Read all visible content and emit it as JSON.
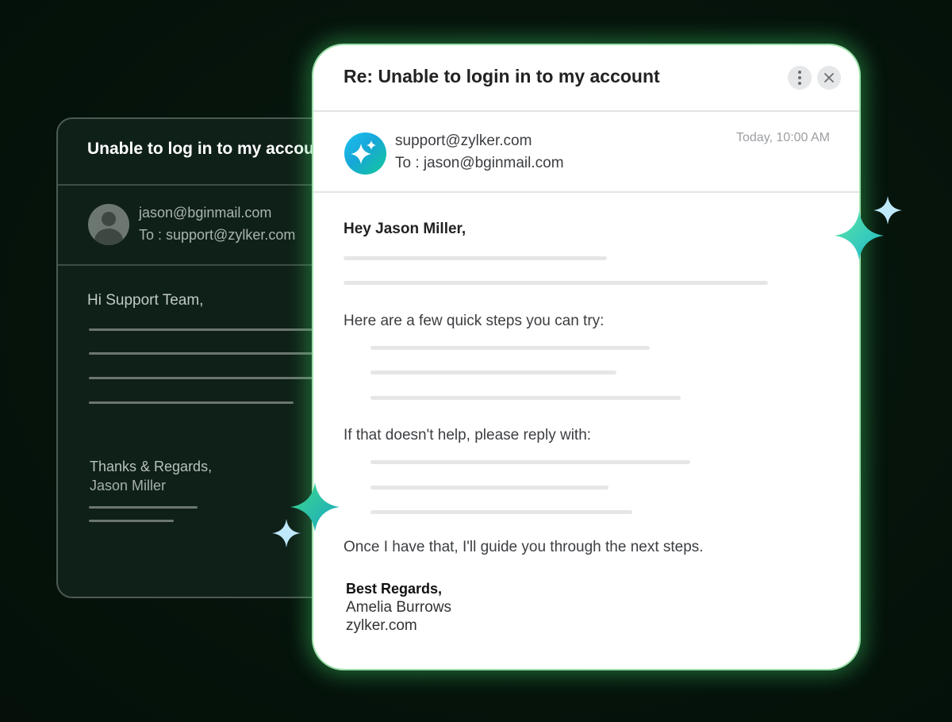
{
  "background_email": {
    "subject": "Unable to log in to my account",
    "from": "jason@bginmail.com",
    "to": "To : support@zylker.com",
    "greeting": "Hi Support Team,",
    "signoff": "Thanks & Regards,",
    "name": "Jason Miller"
  },
  "reply_email": {
    "subject": "Re: Unable to login in to my account",
    "from": "support@zylker.com",
    "to": "To : jason@bginmail.com",
    "time": "Today, 10:00 AM",
    "greeting": "Hey Jason Miller,",
    "steps_intro": "Here are a few quick steps you can try:",
    "reply_intro": "If that doesn't help, please reply with:",
    "closing": "Once I have that, I'll guide you through the next steps.",
    "signature": {
      "signoff": "Best Regards,",
      "name": "Amelia Burrows",
      "company": "zylker.com"
    }
  },
  "icons": [
    "more-options-icon",
    "close-icon",
    "sparkle-avatar-icon",
    "user-avatar-icon",
    "sparkle-icon"
  ],
  "colors": {
    "background": "#06140c",
    "glow": "#3cc864",
    "avatar_gradient_start": "#1ec2f0",
    "avatar_gradient_end": "#12c89a"
  }
}
